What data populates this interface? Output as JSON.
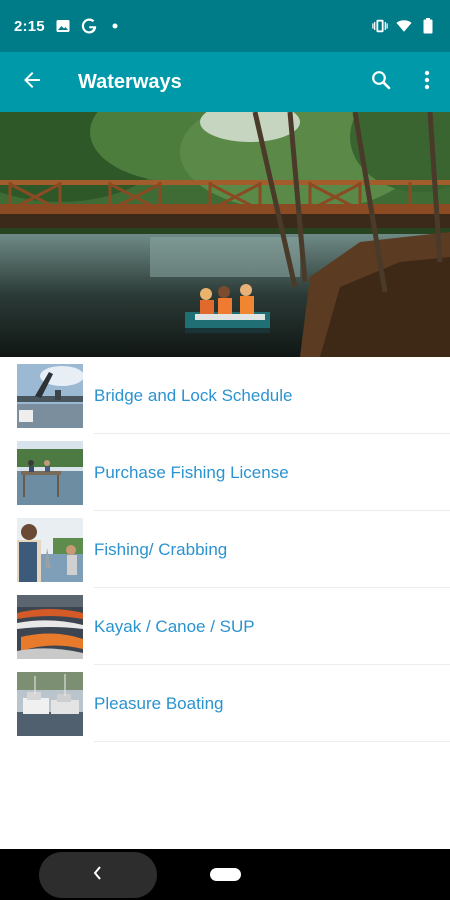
{
  "status_bar": {
    "time": "2:15",
    "icons": [
      "image-icon",
      "google-g-icon",
      "notification-dot-icon",
      "vibrate-icon",
      "wifi-icon",
      "battery-icon"
    ]
  },
  "app_bar": {
    "title": "Waterways",
    "back_icon": "arrow-back-icon",
    "search_icon": "search-icon",
    "more_icon": "more-vert-icon",
    "color": "#0099a9",
    "status_color": "#007c88"
  },
  "hero": {
    "description_icon": "hero-photo"
  },
  "menu": {
    "items": [
      {
        "label": "Bridge and Lock Schedule",
        "thumb": "bridge-thumb"
      },
      {
        "label": "Purchase Fishing License",
        "thumb": "pier-thumb"
      },
      {
        "label": "Fishing/ Crabbing",
        "thumb": "fishing-thumb"
      },
      {
        "label": "Kayak / Canoe / SUP",
        "thumb": "kayak-thumb"
      },
      {
        "label": "Pleasure Boating",
        "thumb": "marina-thumb"
      }
    ],
    "label_color": "#2a93d0"
  },
  "nav_bar": {
    "back_icon": "chevron-left-icon",
    "home_icon": "home-pill-icon"
  }
}
